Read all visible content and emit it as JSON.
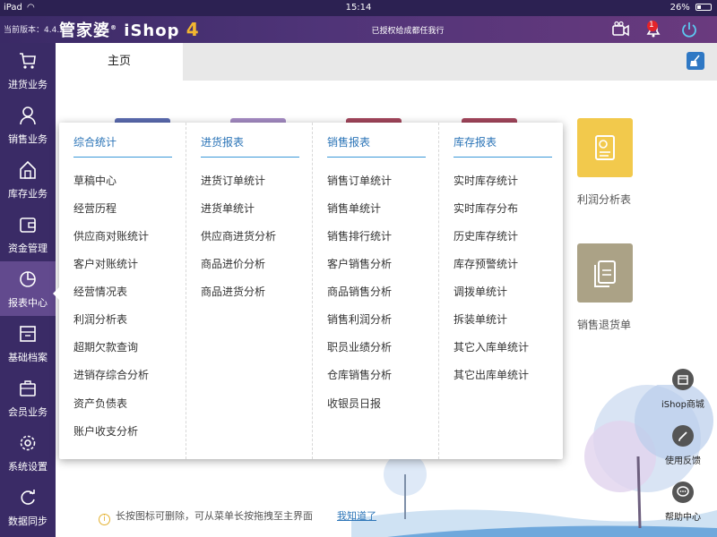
{
  "status_bar": {
    "device": "iPad",
    "time": "15:14",
    "battery": "26%",
    "battery_level": 0.26
  },
  "header": {
    "version": "当前版本：4.4.2",
    "logo_text": "管家婆",
    "logo_product": "iShop",
    "logo_number": "4",
    "authorized_text": "已授权给成都任我行",
    "notification_count": "1",
    "icons": [
      "camera-icon",
      "bell-icon",
      "power-icon"
    ]
  },
  "sidebar": {
    "items": [
      {
        "label": "进货业务",
        "icon": "cart-icon"
      },
      {
        "label": "销售业务",
        "icon": "person-icon"
      },
      {
        "label": "库存业务",
        "icon": "house-icon"
      },
      {
        "label": "资金管理",
        "icon": "wallet-icon"
      },
      {
        "label": "报表中心",
        "icon": "pie-chart-icon",
        "active": true
      },
      {
        "label": "基础档案",
        "icon": "archive-icon"
      },
      {
        "label": "会员业务",
        "icon": "briefcase-icon"
      },
      {
        "label": "系统设置",
        "icon": "gear-icon"
      },
      {
        "label": "数据同步",
        "icon": "sync-icon"
      }
    ]
  },
  "tabs": {
    "home": "主页"
  },
  "tiles": {
    "profit": "利润分析表",
    "sales_return": "销售退货单"
  },
  "menu": {
    "columns": [
      {
        "title": "综合统计",
        "items": [
          "草稿中心",
          "经营历程",
          "供应商对账统计",
          "客户对账统计",
          "经营情况表",
          "利润分析表",
          "超期欠款查询",
          "进销存综合分析",
          "资产负债表",
          "账户收支分析"
        ]
      },
      {
        "title": "进货报表",
        "items": [
          "进货订单统计",
          "进货单统计",
          "供应商进货分析",
          "商品进价分析",
          "商品进货分析"
        ]
      },
      {
        "title": "销售报表",
        "items": [
          "销售订单统计",
          "销售单统计",
          "销售排行统计",
          "客户销售分析",
          "商品销售分析",
          "销售利润分析",
          "职员业绩分析",
          "仓库销售分析",
          "收银员日报"
        ]
      },
      {
        "title": "库存报表",
        "items": [
          "实时库存统计",
          "实时库存分布",
          "历史库存统计",
          "库存预警统计",
          "调拨单统计",
          "拆装单统计",
          "其它入库单统计",
          "其它出库单统计"
        ]
      }
    ]
  },
  "tip": {
    "text": "长按图标可删除，可从菜单长按拖拽至主界面",
    "link": "我知道了"
  },
  "float_buttons": [
    {
      "label": "iShop商城",
      "icon": "shop-icon"
    },
    {
      "label": "使用反馈",
      "icon": "pen-icon"
    },
    {
      "label": "帮助中心",
      "icon": "chat-icon"
    }
  ],
  "colors": {
    "sidebar": "#3a2b66",
    "accent_blue": "#2b74b7",
    "tile_yellow": "#f2c94c",
    "tile_olive": "#aba286"
  }
}
